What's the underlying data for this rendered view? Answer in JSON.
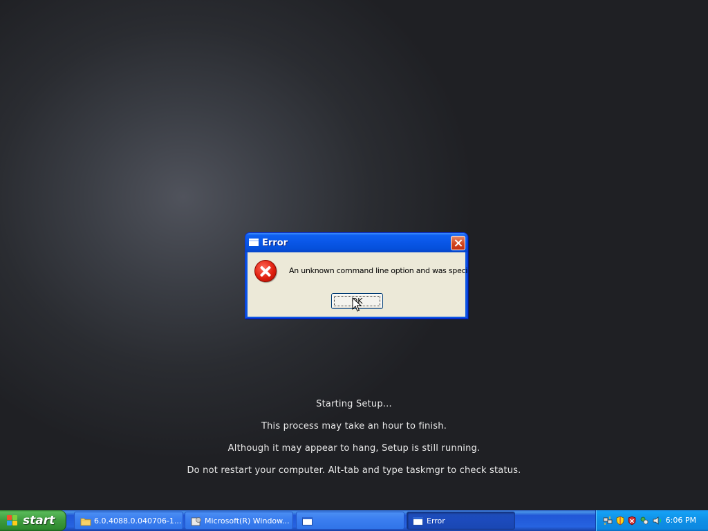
{
  "setup_status": {
    "line1": "Starting Setup...",
    "line2": "This process may take an hour to finish.",
    "line3": "Although it may appear to hang, Setup is still running.",
    "line4": "Do not restart your computer.  Alt-tab and type taskmgr to check status."
  },
  "dialog": {
    "title": "Error",
    "message": "An unknown command line option and was specified.",
    "ok_label": "OK",
    "icon": "error-icon"
  },
  "taskbar": {
    "start_label": "start",
    "items": [
      {
        "label": "6.0.4088.0.040706-1...",
        "icon": "folder-icon"
      },
      {
        "label": "Microsoft(R) Window...",
        "icon": "setup-icon"
      },
      {
        "label": "",
        "icon": "window-icon"
      },
      {
        "label": "Error",
        "icon": "window-icon",
        "active": true
      }
    ],
    "tray_icons": [
      "network-icon",
      "security-shield-icon",
      "antivirus-icon",
      "sync-icon",
      "volume-icon"
    ],
    "clock": "6:06 PM"
  }
}
